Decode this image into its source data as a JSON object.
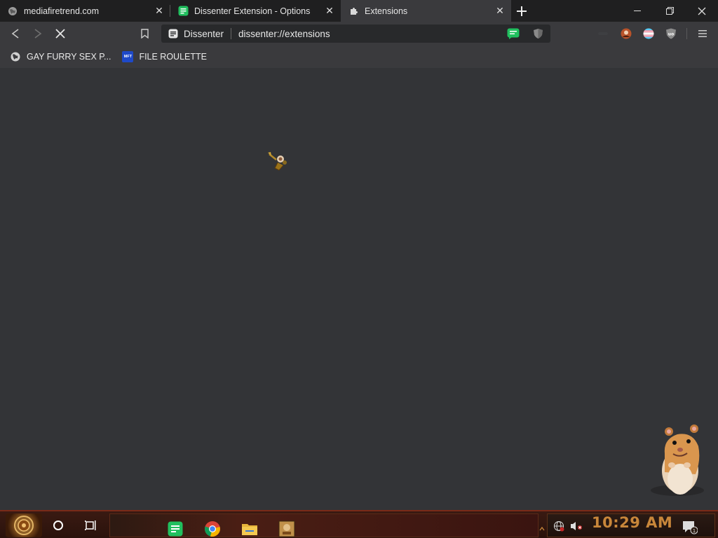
{
  "tabs": [
    {
      "label": "mediafiretrend.com",
      "icon": "globe-icon",
      "active": false
    },
    {
      "label": "Dissenter Extension - Options",
      "icon": "dissenter-icon",
      "active": false
    },
    {
      "label": "Extensions",
      "icon": "puzzle-icon",
      "active": true
    }
  ],
  "new_tab_icon": "plus-icon",
  "window_controls": [
    "minimize-icon",
    "restore-icon",
    "close-icon"
  ],
  "toolbar": {
    "back_icon": "back-icon",
    "forward_icon": "forward-icon",
    "stop_icon": "stop-icon",
    "bookmark_icon": "bookmark-icon",
    "menu_icon": "menu-icon"
  },
  "omnibox": {
    "site_name": "Dissenter",
    "url": "dissenter://extensions"
  },
  "bookmarks": [
    {
      "label": "GAY FURRY SEX P...",
      "icon": "globe-icon"
    },
    {
      "label": "FILE ROULETTE",
      "icon": "mft-icon",
      "icon_text": "MFT"
    }
  ],
  "taskbar": {
    "clock": "10:29 AM",
    "apps": [
      "dissenter-app-icon",
      "chrome-icon",
      "file-explorer-icon",
      "media-box-icon"
    ],
    "notification_count": "1",
    "accent_color": "#c8863a"
  },
  "colors": {
    "dissenter_green": "#21c05f",
    "content_bg": "#333437",
    "toolbar_bg": "#3a3a3d"
  }
}
